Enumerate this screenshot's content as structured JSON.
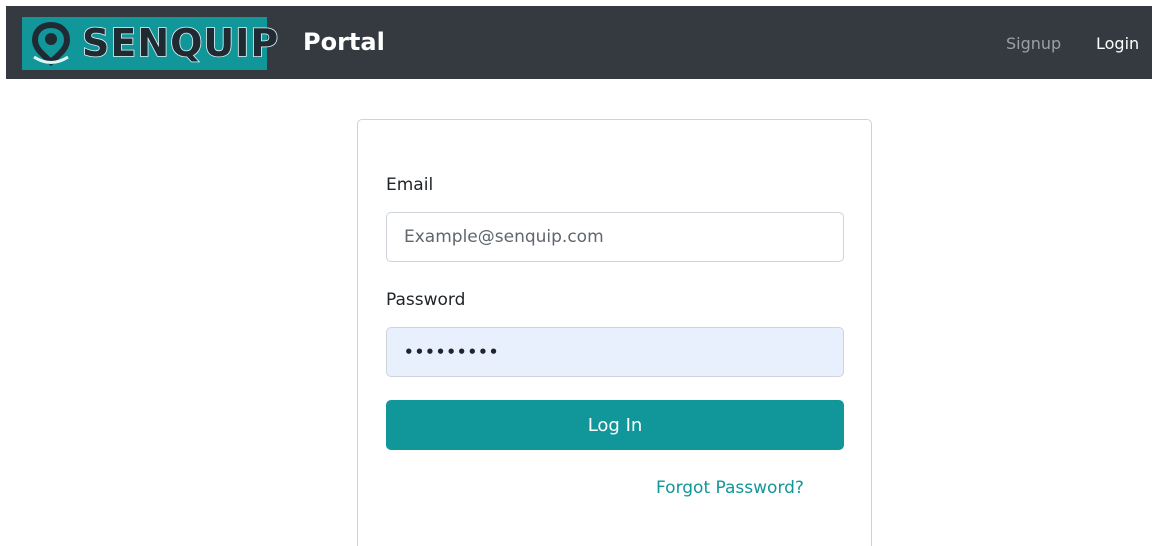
{
  "navbar": {
    "brand_text": "SENQUIP",
    "title": "Portal",
    "links": {
      "signup": "Signup",
      "login": "Login"
    }
  },
  "form": {
    "email_label": "Email",
    "email_placeholder": "Example@senquip.com",
    "email_value": "",
    "password_label": "Password",
    "password_value": "abcdefghi",
    "submit_label": "Log In",
    "forgot_label": "Forgot Password?"
  },
  "colors": {
    "navbar_bg": "#343a40",
    "brand_teal": "#11969a",
    "autofill_bg": "#e8f0fe"
  },
  "icons": {
    "logo": "senquip-location-pin-icon"
  }
}
